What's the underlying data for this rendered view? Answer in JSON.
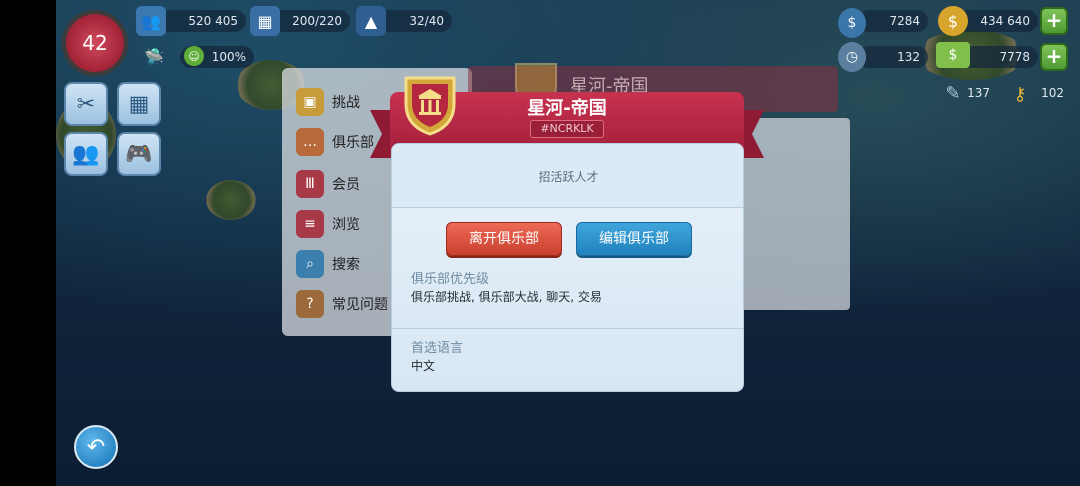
{
  "hud": {
    "level": "42",
    "population": "520 405",
    "storage_capacity": "200/220",
    "workers": "32/40",
    "happiness": "100%",
    "simcash": "7284",
    "coins": "434 640",
    "time": "132",
    "money": "7778",
    "blueprints": "137",
    "keys": "102"
  },
  "club_menu": {
    "items": [
      {
        "label": "挑战",
        "icon": "chest-icon"
      },
      {
        "label": "俱乐部",
        "icon": "chat-icon"
      },
      {
        "label": "会员",
        "icon": "bank-shield-icon"
      },
      {
        "label": "浏览",
        "icon": "list-shield-icon"
      },
      {
        "label": "搜索",
        "icon": "magnifier-icon"
      },
      {
        "label": "常见问题",
        "icon": "book-icon"
      }
    ]
  },
  "background_banner_title": "星河-帝国",
  "club": {
    "name": "星河-帝国",
    "tag": "#NCRKLK",
    "motto": "招活跃人才",
    "leave_label": "离开俱乐部",
    "edit_label": "编辑俱乐部",
    "priority_label": "俱乐部优先级",
    "priority_value": "俱乐部挑战, 俱乐部大战, 聊天, 交易",
    "language_label": "首选语言",
    "language_value": "中文"
  },
  "colors": {
    "banner": "#c8324f",
    "leave_button": "#d9503c",
    "edit_button": "#2a8fcb",
    "dialog_bg": "#e3eef8"
  }
}
